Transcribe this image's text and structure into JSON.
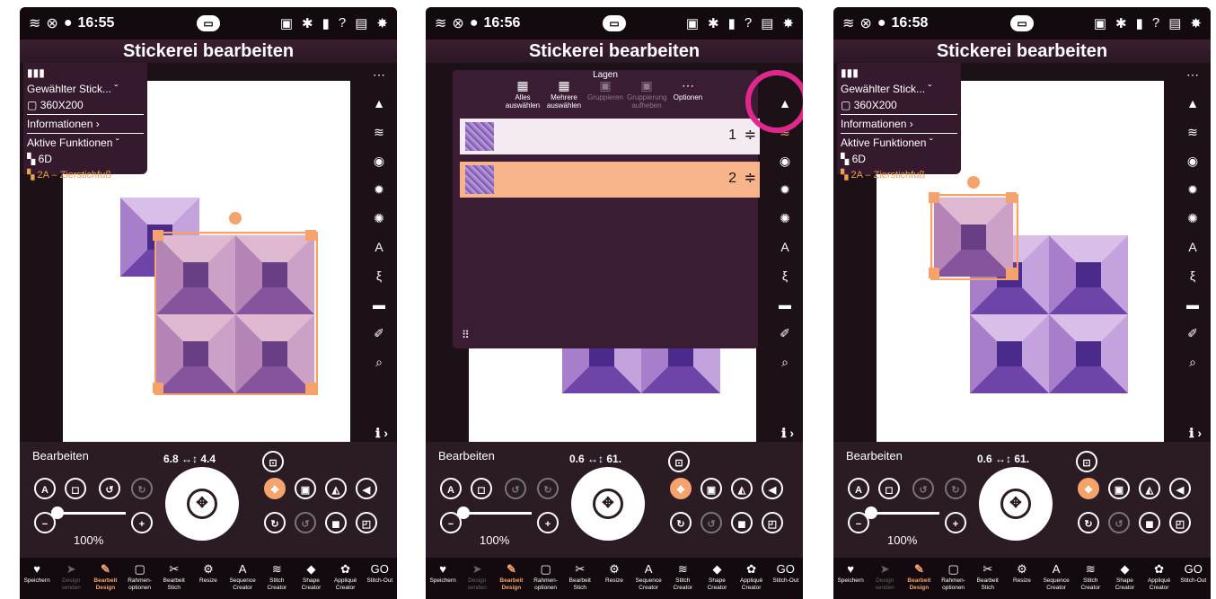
{
  "screens": [
    {
      "time": "16:55"
    },
    {
      "time": "16:56"
    },
    {
      "time": "16:58"
    }
  ],
  "title": "Stickerei bearbeiten",
  "info_panel": {
    "selected_label": "Gewählter Stick...",
    "hoop": "360X200",
    "info": "Informationen",
    "active": "Aktive Funktionen",
    "foot": "6D",
    "presser": "2A – Zierstichfuß"
  },
  "edit": {
    "label": "Bearbeiten",
    "zoom": "100%",
    "dims_screens": [
      "6.8 ↔↕ 4.4",
      "0.6 ↔↕ 61.",
      "0.6 ↔↕ 61."
    ]
  },
  "layers": {
    "header": "Lagen",
    "select_all": "Alles auswählen",
    "select_multi": "Mehrere auswählen",
    "group": "Gruppieren",
    "ungroup": "Gruppierung aufheben",
    "options": "Optionen",
    "row1": "1",
    "row2": "2"
  },
  "bottom_nav": [
    {
      "icon": "♥",
      "label": "Speichern",
      "state": "normal"
    },
    {
      "icon": "➤",
      "label": "Design senden",
      "state": "dim"
    },
    {
      "icon": "✎",
      "label": "Bearbeit Design",
      "state": "active"
    },
    {
      "icon": "▢",
      "label": "Rahmen-optionen",
      "state": "normal"
    },
    {
      "icon": "✂",
      "label": "Bearbeit Stich",
      "state": "normal"
    },
    {
      "icon": "⚙",
      "label": "Resize",
      "state": "normal"
    },
    {
      "icon": "A",
      "label": "Sequence Creator",
      "state": "normal"
    },
    {
      "icon": "≋",
      "label": "Stitch Creator",
      "state": "normal"
    },
    {
      "icon": "◆",
      "label": "Shape Creator",
      "state": "normal"
    },
    {
      "icon": "✿",
      "label": "Appliqué Creator",
      "state": "normal"
    },
    {
      "icon": "GO",
      "label": "Stitch-Out",
      "state": "normal"
    }
  ],
  "colors": {
    "accent": "#f5a36c",
    "highlight": "#e0288c"
  }
}
